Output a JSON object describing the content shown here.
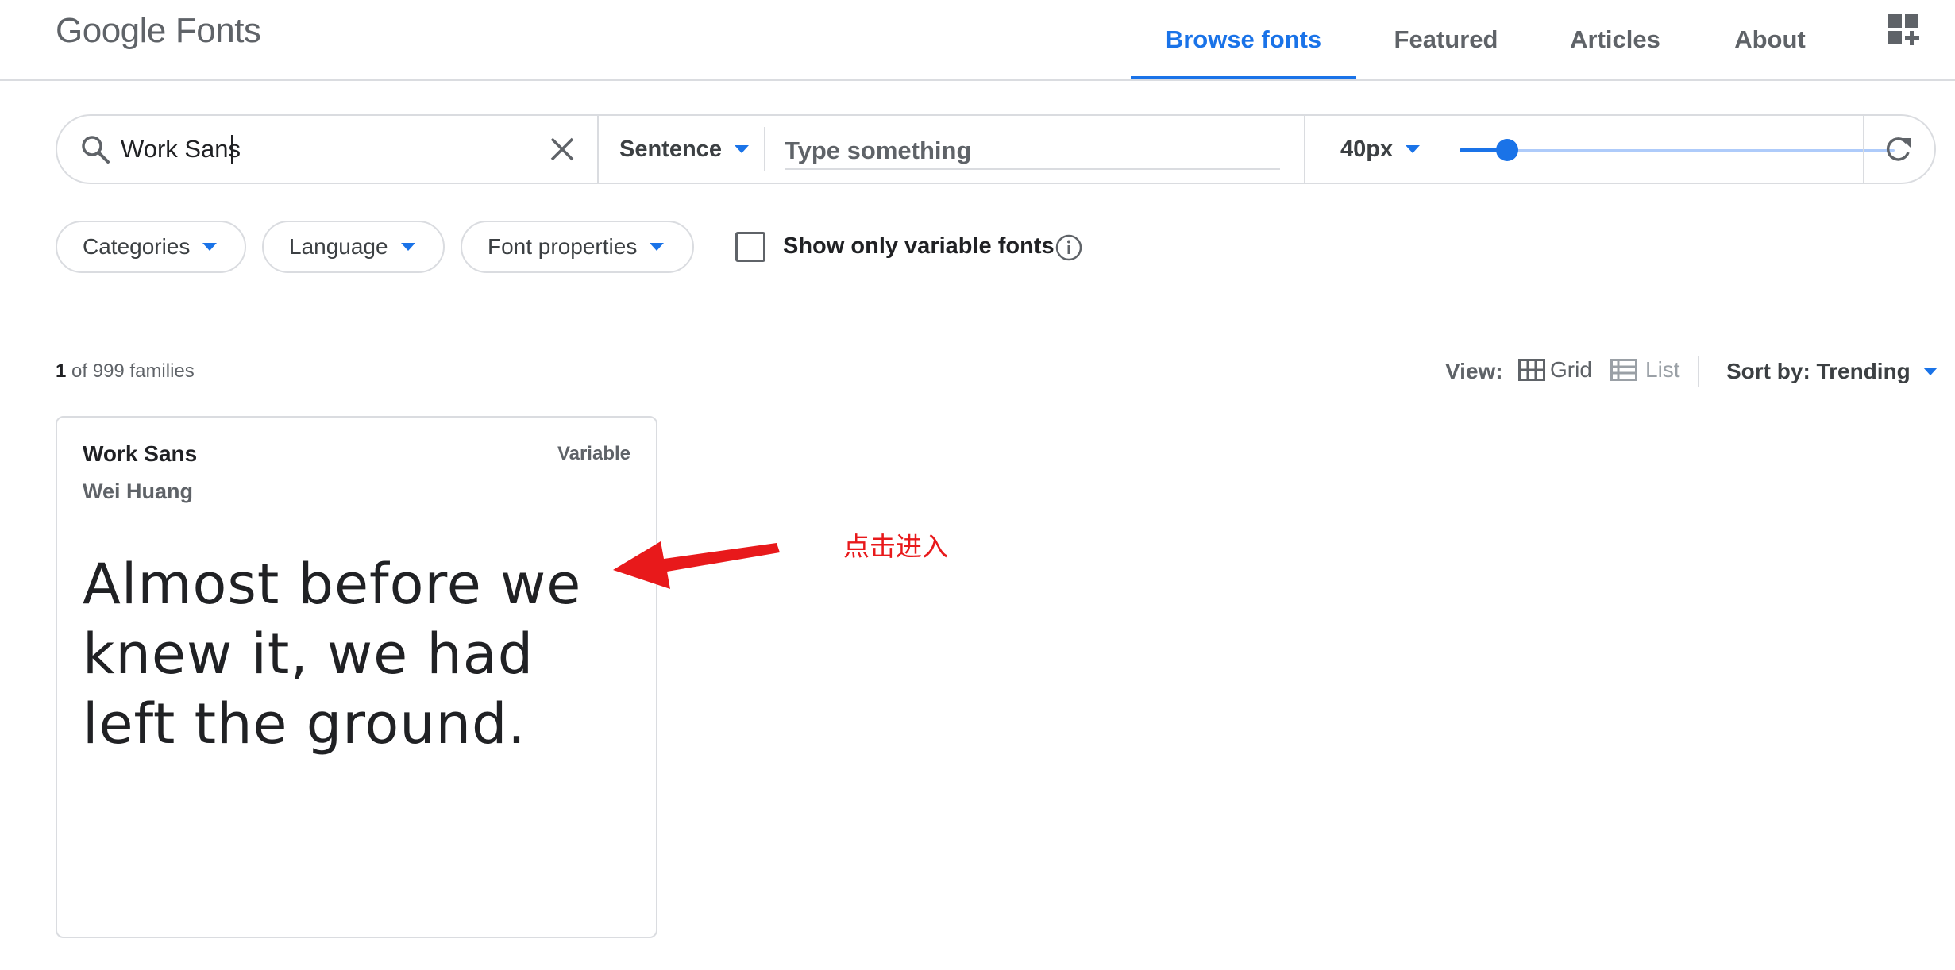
{
  "header": {
    "logo_word1": "Google",
    "logo_word2": "Fonts",
    "nav": [
      "Browse fonts",
      "Featured",
      "Articles",
      "About"
    ],
    "active_nav": "Browse fonts",
    "apps_icon": "apps-add-icon"
  },
  "toolbar": {
    "search_value": "Work Sans",
    "search_icon": "search-icon",
    "clear_icon": "close-icon",
    "preview_mode": "Sentence",
    "type_placeholder": "Type something",
    "size_value": "40px",
    "size_slider_fraction": 0.11,
    "refresh_icon": "refresh-icon"
  },
  "filters": {
    "categories": "Categories",
    "language": "Language",
    "font_properties": "Font properties",
    "variable_checkbox_label": "Show only variable fonts",
    "variable_checked": false,
    "info_icon": "info-icon"
  },
  "results": {
    "count_number": "1",
    "count_suffix": "of 999 families",
    "view_label": "View:",
    "view_grid": "Grid",
    "view_list": "List",
    "sort_label": "Sort by: Trending"
  },
  "cards": [
    {
      "name": "Work Sans",
      "author": "Wei Huang",
      "tag": "Variable",
      "sample": "Almost before we knew it, we had left the ground."
    }
  ],
  "annotation": {
    "text": "点击进入",
    "color": "#e8191b"
  },
  "colors": {
    "accent": "#1a73e8",
    "border": "#dadce0",
    "text_secondary": "#5f6368"
  }
}
